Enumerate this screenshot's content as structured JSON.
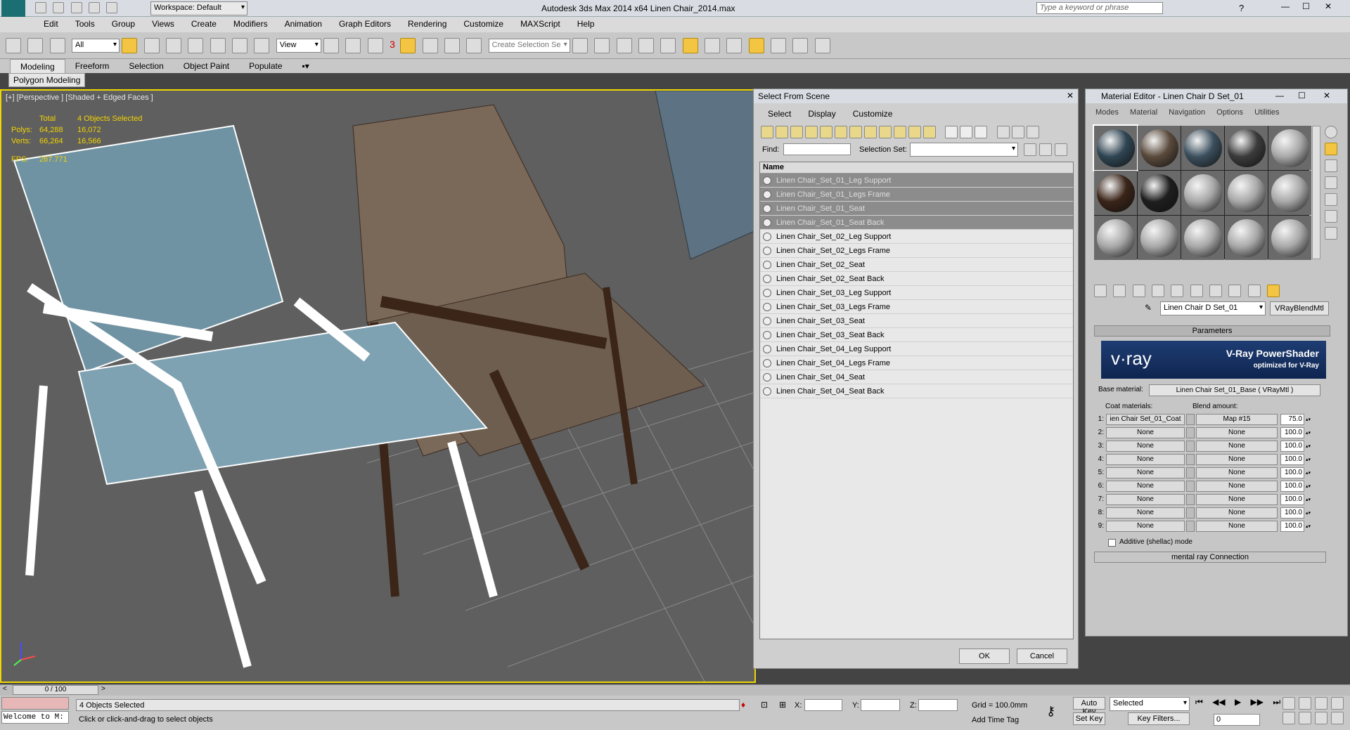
{
  "titlebar": {
    "workspace": "Workspace: Default",
    "title": "Autodesk 3ds Max  2014 x64      Linen Chair_2014.max",
    "search_placeholder": "Type a keyword or phrase"
  },
  "menubar": [
    "Edit",
    "Tools",
    "Group",
    "Views",
    "Create",
    "Modifiers",
    "Animation",
    "Graph Editors",
    "Rendering",
    "Customize",
    "MAXScript",
    "Help"
  ],
  "toolbar": {
    "filter_value": "All",
    "refcoord_value": "View",
    "snap_label": "3",
    "selection_set_placeholder": "Create Selection Se"
  },
  "ribbon": {
    "tabs": [
      "Modeling",
      "Freeform",
      "Selection",
      "Object Paint",
      "Populate"
    ],
    "sub": "Polygon Modeling"
  },
  "viewport": {
    "label": "[+] [Perspective ] [Shaded + Edged Faces ]",
    "stats": {
      "total_label": "Total",
      "selected_label": "4 Objects Selected",
      "polys_label": "Polys:",
      "polys_total": "64,288",
      "polys_sel": "16,072",
      "verts_label": "Verts:",
      "verts_total": "66,264",
      "verts_sel": "16,566",
      "fps_label": "FPS:",
      "fps_value": "267.771"
    }
  },
  "select_dialog": {
    "title": "Select From Scene",
    "menu": [
      "Select",
      "Display",
      "Customize"
    ],
    "find_label": "Find:",
    "selection_set_label": "Selection Set:",
    "column_name": "Name",
    "items": [
      {
        "name": "Linen Chair_Set_01_Leg Support",
        "selected": true
      },
      {
        "name": "Linen Chair_Set_01_Legs Frame",
        "selected": true
      },
      {
        "name": "Linen Chair_Set_01_Seat",
        "selected": true
      },
      {
        "name": "Linen Chair_Set_01_Seat Back",
        "selected": true
      },
      {
        "name": "Linen Chair_Set_02_Leg Support",
        "selected": false
      },
      {
        "name": "Linen Chair_Set_02_Legs Frame",
        "selected": false
      },
      {
        "name": "Linen Chair_Set_02_Seat",
        "selected": false
      },
      {
        "name": "Linen Chair_Set_02_Seat Back",
        "selected": false
      },
      {
        "name": "Linen Chair_Set_03_Leg Support",
        "selected": false
      },
      {
        "name": "Linen Chair_Set_03_Legs Frame",
        "selected": false
      },
      {
        "name": "Linen Chair_Set_03_Seat",
        "selected": false
      },
      {
        "name": "Linen Chair_Set_03_Seat Back",
        "selected": false
      },
      {
        "name": "Linen Chair_Set_04_Leg Support",
        "selected": false
      },
      {
        "name": "Linen Chair_Set_04_Legs Frame",
        "selected": false
      },
      {
        "name": "Linen Chair_Set_04_Seat",
        "selected": false
      },
      {
        "name": "Linen Chair_Set_04_Seat Back",
        "selected": false
      }
    ],
    "ok_label": "OK",
    "cancel_label": "Cancel"
  },
  "material_editor": {
    "title": "Material Editor - Linen Chair D Set_01",
    "menu": [
      "Modes",
      "Material",
      "Navigation",
      "Options",
      "Utilities"
    ],
    "slot_colors": [
      "#2f4553",
      "#5a4a3c",
      "#3b4f5d",
      "#3b3b3b",
      "#a8a8a8",
      "#3a2418",
      "#1e1e1e",
      "#a8a8a8",
      "#a8a8a8",
      "#a8a8a8",
      "#a8a8a8",
      "#a8a8a8",
      "#a8a8a8",
      "#a8a8a8",
      "#a8a8a8"
    ],
    "material_name": "Linen Chair D Set_01",
    "material_type": "VRayBlendMtl",
    "params_header": "Parameters",
    "vray_logo": "v·ray",
    "vray_title": "V-Ray PowerShader",
    "vray_sub": "optimized for V-Ray",
    "base_label": "Base material:",
    "base_value": "Linen Chair Set_01_Base  ( VRayMtl )",
    "coat_label": "Coat materials:",
    "blend_label": "Blend amount:",
    "coats": [
      {
        "n": "1:",
        "mat": "ien Chair Set_01_Coat",
        "map": "Map #15",
        "amount": "75.0"
      },
      {
        "n": "2:",
        "mat": "None",
        "map": "None",
        "amount": "100.0"
      },
      {
        "n": "3:",
        "mat": "None",
        "map": "None",
        "amount": "100.0"
      },
      {
        "n": "4:",
        "mat": "None",
        "map": "None",
        "amount": "100.0"
      },
      {
        "n": "5:",
        "mat": "None",
        "map": "None",
        "amount": "100.0"
      },
      {
        "n": "6:",
        "mat": "None",
        "map": "None",
        "amount": "100.0"
      },
      {
        "n": "7:",
        "mat": "None",
        "map": "None",
        "amount": "100.0"
      },
      {
        "n": "8:",
        "mat": "None",
        "map": "None",
        "amount": "100.0"
      },
      {
        "n": "9:",
        "mat": "None",
        "map": "None",
        "amount": "100.0"
      }
    ],
    "additive_label": "Additive (shellac) mode",
    "mentalray_label": "mental ray Connection"
  },
  "timeline": {
    "frame": "0 / 100"
  },
  "status": {
    "welcome": "Welcome to M:",
    "selected": "4 Objects Selected",
    "prompt": "Click or click-and-drag to select objects",
    "x_label": "X:",
    "y_label": "Y:",
    "z_label": "Z:",
    "grid": "Grid = 100.0mm",
    "add_time_tag": "Add Time Tag",
    "auto_key": "Auto Key",
    "set_key": "Set Key",
    "key_mode": "Selected",
    "key_filters": "Key Filters...",
    "frame_value": "0"
  }
}
